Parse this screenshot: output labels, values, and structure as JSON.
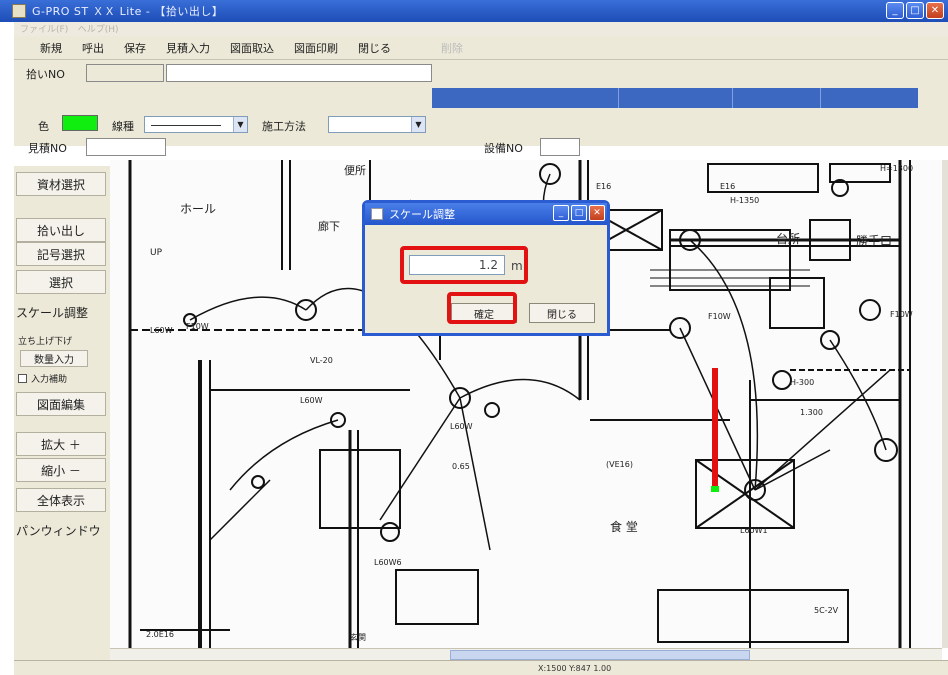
{
  "window": {
    "title": "G-PRO ST ＸＸ Lite - 【拾い出し】"
  },
  "menubar": {
    "items": [
      "ファイル(F)",
      "ヘルプ(H)"
    ]
  },
  "toolbar": {
    "buttons": [
      "新規",
      "呼出",
      "保存",
      "見積入力",
      "図面取込",
      "図面印刷",
      "閉じる"
    ],
    "disabled_button": "削除"
  },
  "propbar": {
    "hiroi_no_label": "拾いNO",
    "color_label": "色",
    "color_value": "#10ee10",
    "line_type_label": "線種",
    "method_label": "施工方法",
    "estimate_no_label": "見積NO",
    "equipment_no_label": "設備NO"
  },
  "sidebar": {
    "buttons": [
      "資材選択",
      "拾い出し",
      "記号選択",
      "選択",
      "スケール調整"
    ],
    "rise_fall_label": "立ち上げ下げ",
    "qty_input_button": "数量入力",
    "input_assist_label": "入力補助",
    "buttons2": [
      "図面編集",
      "拡大 ＋",
      "縮小 －",
      "全体表示",
      "パンウィンドウ"
    ]
  },
  "dialog": {
    "title": "スケール調整",
    "scale_value": "1.2",
    "unit": "m",
    "confirm_button": "確定",
    "close_button": "閉じる"
  },
  "drawing": {
    "labels": [
      "ホール",
      "廊下",
      "台所",
      "勝手口",
      "食 堂",
      "UP",
      "L60W",
      "L60W",
      "L60W",
      "L60W6",
      "L60W1",
      "F10W",
      "1.300",
      "2.0E16",
      "H=1300",
      "0.65",
      "(VE16)",
      "5C-2V",
      "VL-20",
      "F10W",
      "H-300",
      "H-1350",
      "便所",
      "E16",
      "E16",
      "F10W",
      "玄関"
    ]
  },
  "status": {
    "text": "X:1500 Y:847 1.00"
  },
  "colors": {
    "accent": "#2a5bd0",
    "highlight": "#e21212",
    "measure_line": "#e21212"
  }
}
